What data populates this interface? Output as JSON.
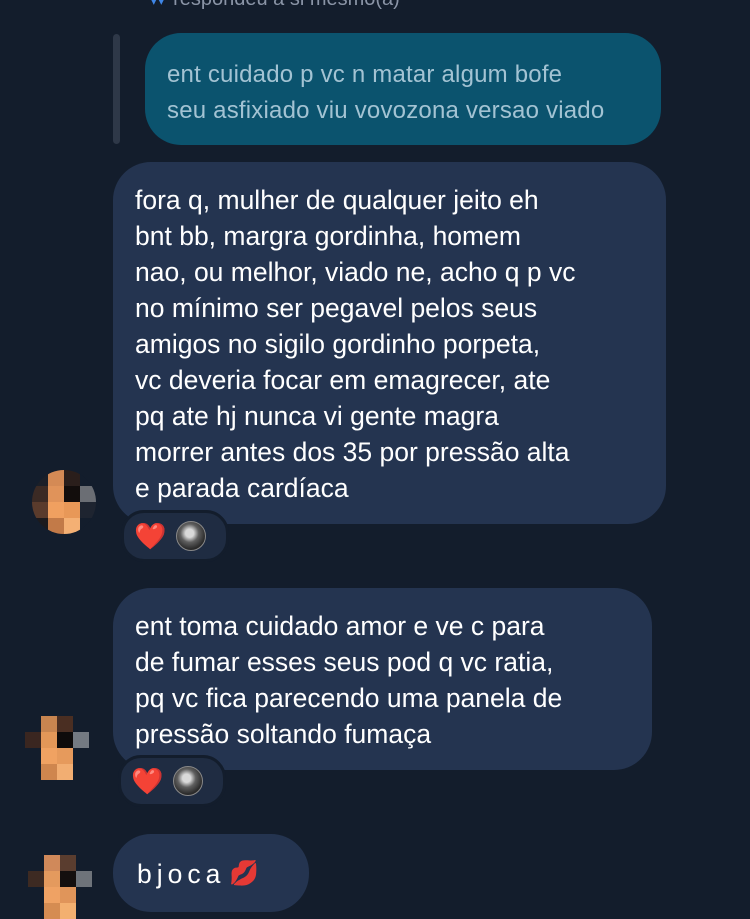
{
  "reply_header": {
    "icon": "reply-arrow-icon",
    "text": "respondeu a si mesmo(a)"
  },
  "quoted_message": {
    "lines": [
      "ent cuidado p vc n matar algum bofe",
      "seu asfixiado viu vovozona versao viado"
    ]
  },
  "messages": [
    {
      "lines": [
        "fora q, mulher de qualquer jeito eh",
        "bnt bb, margra gordinha, homem",
        "nao, ou melhor, viado ne, acho q p vc",
        "no mínimo ser pegavel pelos seus",
        "amigos no sigilo gordinho porpeta,",
        "vc deveria focar em emagrecer, ate",
        "pq ate hj nunca vi gente magra",
        "morrer antes dos 35 por pressão alta",
        "e parada cardíaca"
      ],
      "reaction": {
        "emoji": "❤️",
        "icon": "reactor-avatar-icon"
      }
    },
    {
      "lines": [
        "ent toma cuidado amor e ve c para",
        "de fumar esses seus pod q vc ratia,",
        "pq vc fica parecendo uma panela de",
        "pressão soltando fumaça"
      ],
      "reaction": {
        "emoji": "❤️",
        "icon": "reactor-avatar-icon"
      }
    },
    {
      "text": "bjoca",
      "emoji": "💋"
    }
  ],
  "colors": {
    "background": "#131d2c",
    "bubble": "#243450",
    "quoted_bubble": "#0b536e",
    "heart": "#f42b47"
  }
}
